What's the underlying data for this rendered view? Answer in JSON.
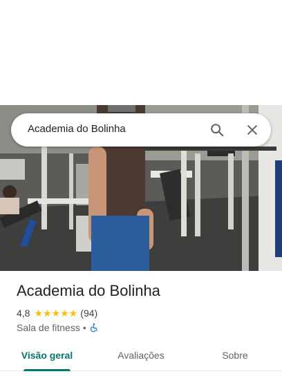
{
  "search": {
    "query": "Academia do Bolinha",
    "search_icon": "search-icon",
    "close_icon": "close-icon"
  },
  "photo": {
    "subject": "gym-interior-photo"
  },
  "place": {
    "name": "Academia do Bolinha",
    "rating": "4,8",
    "stars": 5,
    "review_count": "(94)",
    "category": "Sala de fitness",
    "separator": "•",
    "accessibility_icon": "wheelchair-icon"
  },
  "tabs": [
    {
      "label": "Visão geral",
      "active": true
    },
    {
      "label": "Avaliações",
      "active": false
    },
    {
      "label": "Sobre",
      "active": false
    }
  ],
  "colors": {
    "accent": "#00796b",
    "star": "#fbbc04",
    "accessibility": "#1a73e8"
  }
}
